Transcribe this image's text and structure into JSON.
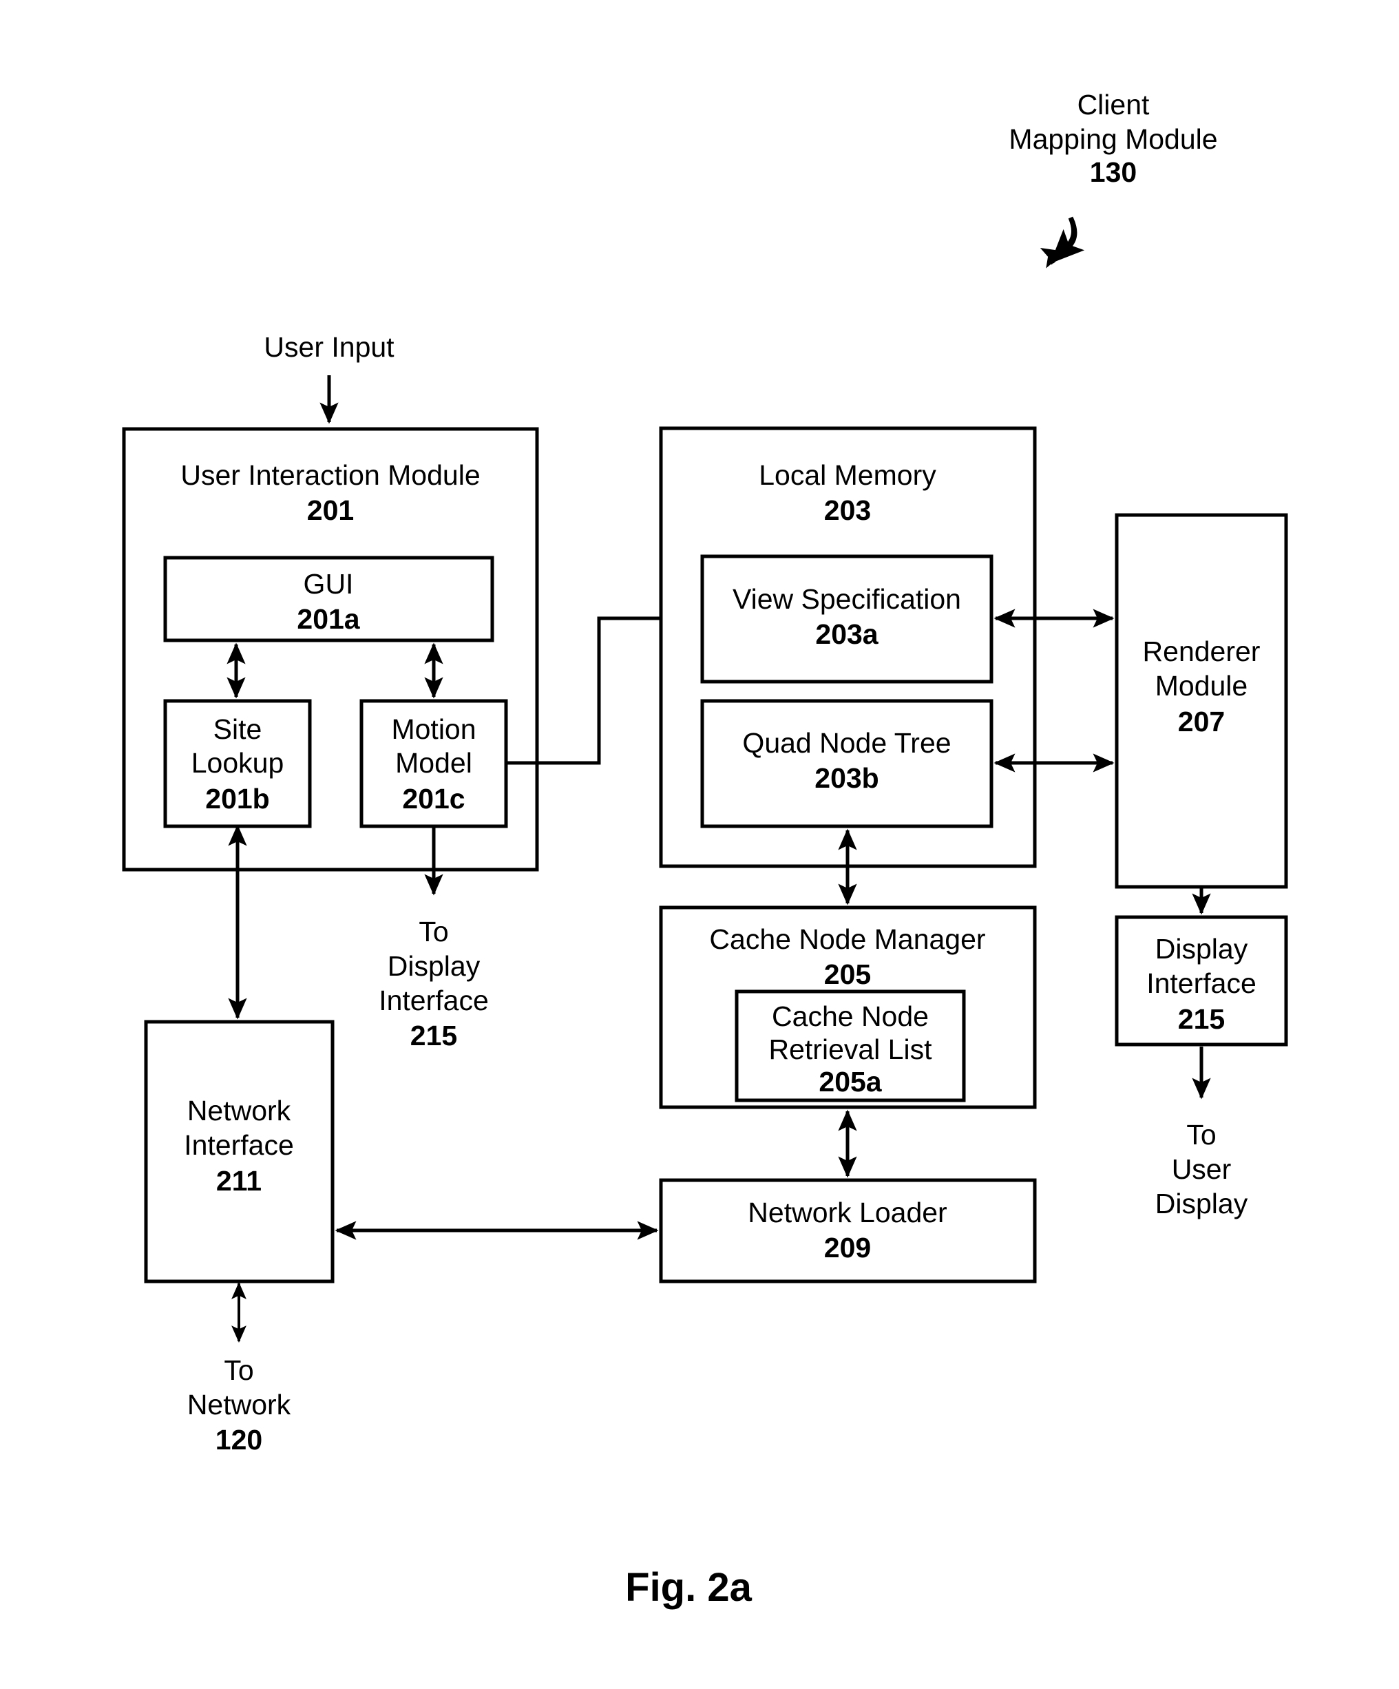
{
  "figure": {
    "caption": "Fig. 2a",
    "header": {
      "line1": "Client",
      "line2": "Mapping Module",
      "ref": "130"
    }
  },
  "free_labels": {
    "user_input": "User Input",
    "to_display_interface": {
      "l1": "To",
      "l2": "Display",
      "l3": "Interface",
      "ref": "215"
    },
    "to_user_display": {
      "l1": "To",
      "l2": "User",
      "l3": "Display"
    },
    "to_network": {
      "l1": "To",
      "l2": "Network",
      "ref": "120"
    }
  },
  "blocks": {
    "user_interaction_module": {
      "title": "User Interaction Module",
      "ref": "201"
    },
    "gui": {
      "title": "GUI",
      "ref": "201a"
    },
    "site_lookup": {
      "l1": "Site",
      "l2": "Lookup",
      "ref": "201b"
    },
    "motion_model": {
      "l1": "Motion",
      "l2": "Model",
      "ref": "201c"
    },
    "local_memory": {
      "title": "Local Memory",
      "ref": "203"
    },
    "view_specification": {
      "title": "View Specification",
      "ref": "203a"
    },
    "quad_node_tree": {
      "title": "Quad Node Tree",
      "ref": "203b"
    },
    "cache_node_manager": {
      "title": "Cache Node Manager",
      "ref": "205"
    },
    "cache_node_retrieval_list": {
      "l1": "Cache Node",
      "l2": "Retrieval List",
      "ref": "205a"
    },
    "network_loader": {
      "title": "Network Loader",
      "ref": "209"
    },
    "network_interface": {
      "l1": "Network",
      "l2": "Interface",
      "ref": "211"
    },
    "renderer_module": {
      "l1": "Renderer",
      "l2": "Module",
      "ref": "207"
    },
    "display_interface": {
      "l1": "Display",
      "l2": "Interface",
      "ref": "215"
    }
  },
  "colors": {
    "stroke": "#000000",
    "fill": "#ffffff",
    "text": "#000000"
  }
}
